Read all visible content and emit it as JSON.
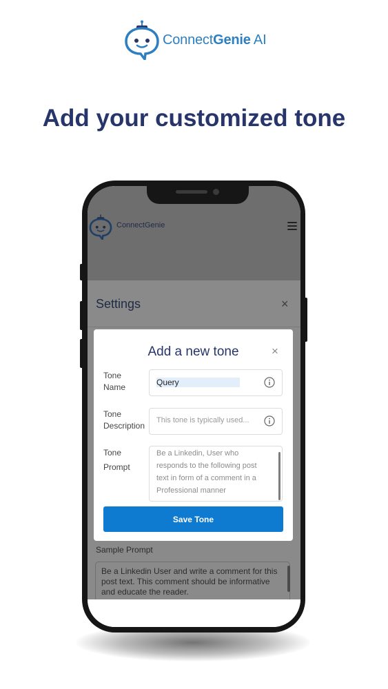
{
  "brand": {
    "name_part1": "Connect",
    "name_part2": "Genie",
    "name_part3": " AI"
  },
  "headline": "Add your customized tone",
  "app": {
    "brand": "ConnectGenie",
    "settings": {
      "title": "Settings",
      "close_glyph": "×",
      "sample_prompt_label": "Sample Prompt",
      "sample_prompt_text": "Be a Linkedin User and write a comment for this post text. This comment should be informative and educate the reader."
    },
    "modal": {
      "title": "Add a new tone",
      "close_glyph": "×",
      "tone_name_label_1": "Tone",
      "tone_name_label_2": "Name",
      "tone_name_value": "Query",
      "tone_description_label_1": "Tone",
      "tone_description_label_2": "Description",
      "tone_description_placeholder": "This tone is typically used...",
      "tone_prompt_label_1": "Tone",
      "tone_prompt_label_2": "Prompt",
      "tone_prompt_lines": [
        "Be a Linkedin, User who",
        "responds to the following  post",
        "text in form of a comment in a",
        "Professional manner"
      ],
      "save_label": "Save Tone"
    }
  },
  "colors": {
    "brand_blue": "#2E7FC1",
    "navy": "#27356B",
    "primary_button": "#0F7BD0"
  },
  "icons": [
    "robot-logo-icon",
    "menu-icon",
    "close-icon",
    "info-icon"
  ]
}
